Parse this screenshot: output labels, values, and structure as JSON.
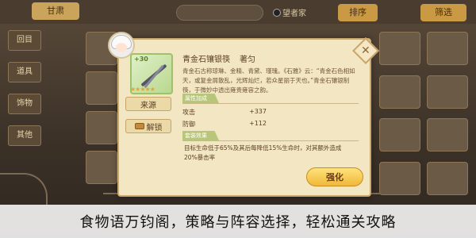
{
  "background": {
    "active_tab": "甘肃",
    "check_label": "望者家",
    "buttons": [
      "排序",
      "筛选"
    ],
    "side_tabs": [
      "回目",
      "道具",
      "饰物",
      "其他"
    ]
  },
  "item": {
    "name": "青金石镶银筷",
    "category": "著匀",
    "plus": "+30",
    "stars": "★★★★★",
    "description": "青金石古称琼琳、金精、青黛、瑾瑰。《石雅》云：“青金石色相如天，或复金屑散乱，光辉灿烂，若众星丽于天也。”青金石镶银制筷，于微妙中透出雍贵雍容之韵。"
  },
  "side_buttons": {
    "source": "来源",
    "unlock": "解锁"
  },
  "sections": {
    "attributes_title": "属性加成",
    "attack_label": "攻击",
    "attack_value": "+337",
    "defense_label": "防御",
    "defense_value": "+112",
    "effect_title": "套装效果",
    "effect_text": "目标生命低于65%及其后每降低15%生命时，对其额外造成20%暴击率"
  },
  "enhance_label": "强化",
  "caption": "食物语万钧阁，策略与阵容选择，轻松通关攻略"
}
